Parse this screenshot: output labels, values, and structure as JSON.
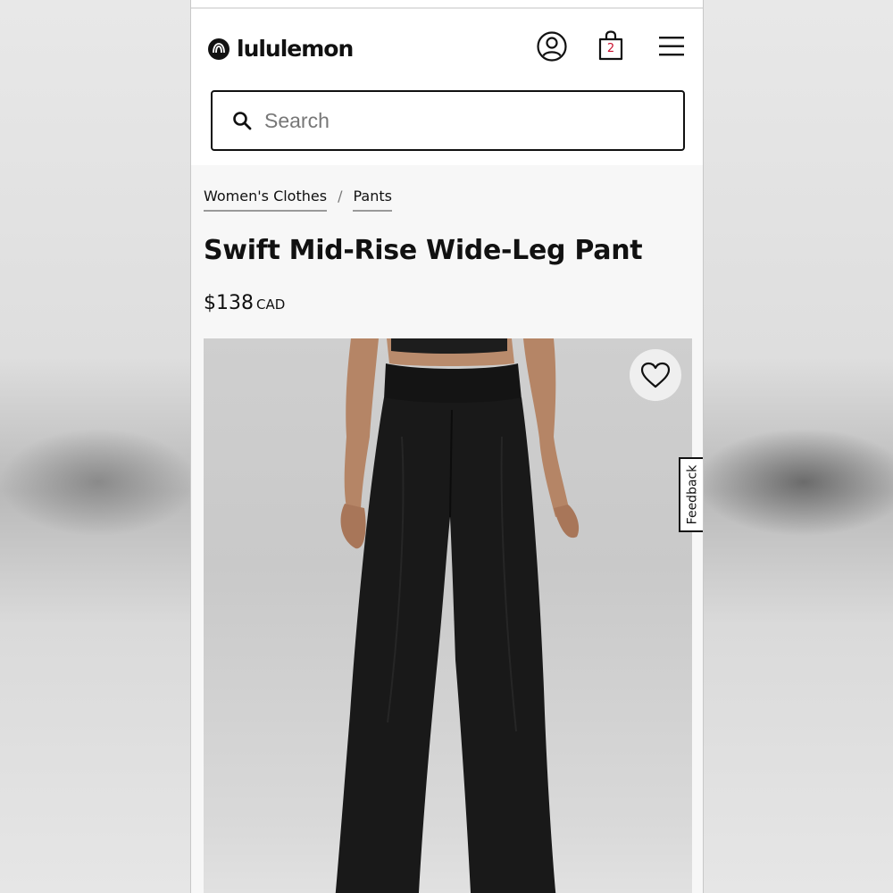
{
  "header": {
    "brand": "lululemon",
    "bag_count": "2",
    "search_placeholder": "Search"
  },
  "breadcrumb": [
    {
      "label": "Women's Clothes"
    },
    {
      "label": "Pants"
    }
  ],
  "breadcrumb_separator": "/",
  "product": {
    "title": "Swift Mid-Rise Wide-Leg Pant",
    "price": "$138",
    "currency": "CAD"
  },
  "feedback_label": "Feedback",
  "icons": {
    "logo": "lululemon-logo-icon",
    "account": "account-icon",
    "bag": "shopping-bag-icon",
    "menu": "hamburger-menu-icon",
    "search": "search-icon",
    "wishlist": "heart-icon"
  },
  "colors": {
    "text": "#111111",
    "bag_count": "#c8102e",
    "page_background": "#f7f7f7"
  }
}
